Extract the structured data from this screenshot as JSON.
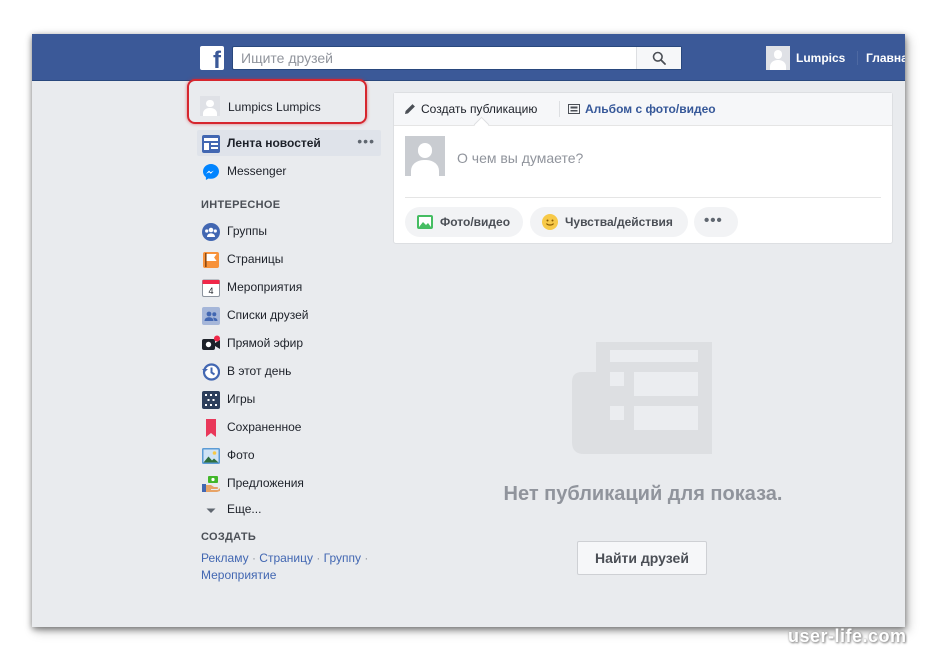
{
  "topbar": {
    "logo_letter": "f",
    "search_placeholder": "Ищите друзей",
    "user_name": "Lumpics",
    "home_label": "Главная",
    "brand_color": "#3b5998"
  },
  "sidebar": {
    "profile_name": "Lumpics Lumpics",
    "items": [
      {
        "label": "Лента новостей",
        "icon": "news-feed-icon",
        "active": true,
        "more": "•••"
      },
      {
        "label": "Messenger",
        "icon": "messenger-icon"
      }
    ],
    "interests_title": "ИНТЕРЕСНОЕ",
    "interests": [
      {
        "label": "Группы",
        "icon": "groups-icon"
      },
      {
        "label": "Страницы",
        "icon": "pages-flag-icon"
      },
      {
        "label": "Мероприятия",
        "icon": "events-calendar-icon",
        "calendar_day": "4"
      },
      {
        "label": "Списки друзей",
        "icon": "friend-lists-icon"
      },
      {
        "label": "Прямой эфир",
        "icon": "live-video-icon"
      },
      {
        "label": "В этот день",
        "icon": "on-this-day-icon"
      },
      {
        "label": "Игры",
        "icon": "games-icon"
      },
      {
        "label": "Сохраненное",
        "icon": "saved-bookmark-icon"
      },
      {
        "label": "Фото",
        "icon": "photos-icon"
      },
      {
        "label": "Предложения",
        "icon": "offers-icon"
      },
      {
        "label": "Еще...",
        "icon": "chevron-down-icon"
      }
    ],
    "create_title": "СОЗДАТЬ",
    "create_links": [
      "Рекламу",
      "Страницу",
      "Группу",
      "Мероприятие"
    ],
    "create_separator": " · "
  },
  "composer": {
    "tab_create": "Создать публикацию",
    "tab_album": "Альбом с фото/видео",
    "prompt": "О чем вы думаете?",
    "btn_photo": "Фото/видео",
    "btn_feelings": "Чувства/действия",
    "btn_more": "•••"
  },
  "feed": {
    "empty_text": "Нет публикаций для показа.",
    "find_friends": "Найти друзей"
  },
  "watermark": "user-life.com",
  "colors": {
    "highlight_ring": "#d6262e",
    "link": "#4267b2",
    "background": "#e9ebee"
  }
}
